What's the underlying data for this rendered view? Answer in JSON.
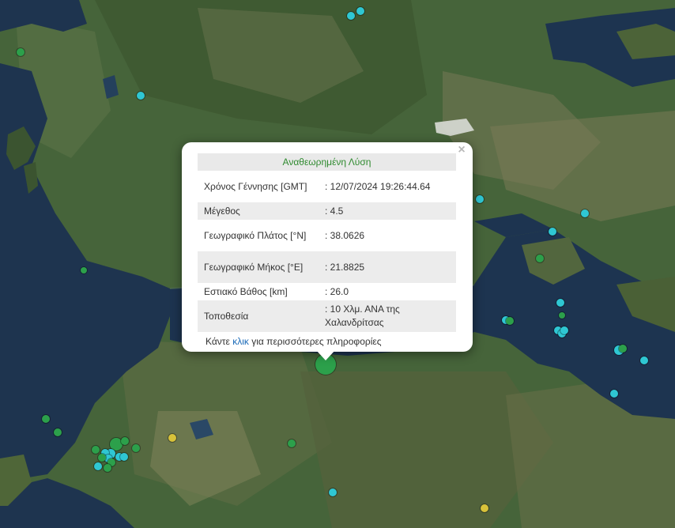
{
  "colors": {
    "green_marker": "#2ca04b",
    "cyan_marker": "#2fc7d3",
    "yellow_marker": "#d8c23a",
    "popup_title": "#2f8a2f",
    "link": "#1a6ab8"
  },
  "popup": {
    "title": "Αναθεωρημένη Λύση",
    "close_icon": "×",
    "rows": [
      {
        "label": "Χρόνος Γέννησης [GMT]",
        "value": ": 12/07/2024 19:26:44.64"
      },
      {
        "label": "Μέγεθος",
        "value": ": 4.5"
      },
      {
        "label": "Γεωγραφικό Πλάτος [°N]",
        "value": ": 38.0626"
      },
      {
        "label": "Γεωγραφικό Μήκος [°E]",
        "value": ": 21.8825"
      },
      {
        "label": "Εστιακό Βάθος [km]",
        "value": ": 26.0"
      },
      {
        "label": "Τοποθεσία",
        "value": ": 10 Χλμ. ΑΝΑ της Χαλανδρίτσας"
      }
    ],
    "more_prefix": "Κάντε ",
    "more_link": "κλικ",
    "more_suffix": " για περισσότερες πληροφορίες"
  }
}
